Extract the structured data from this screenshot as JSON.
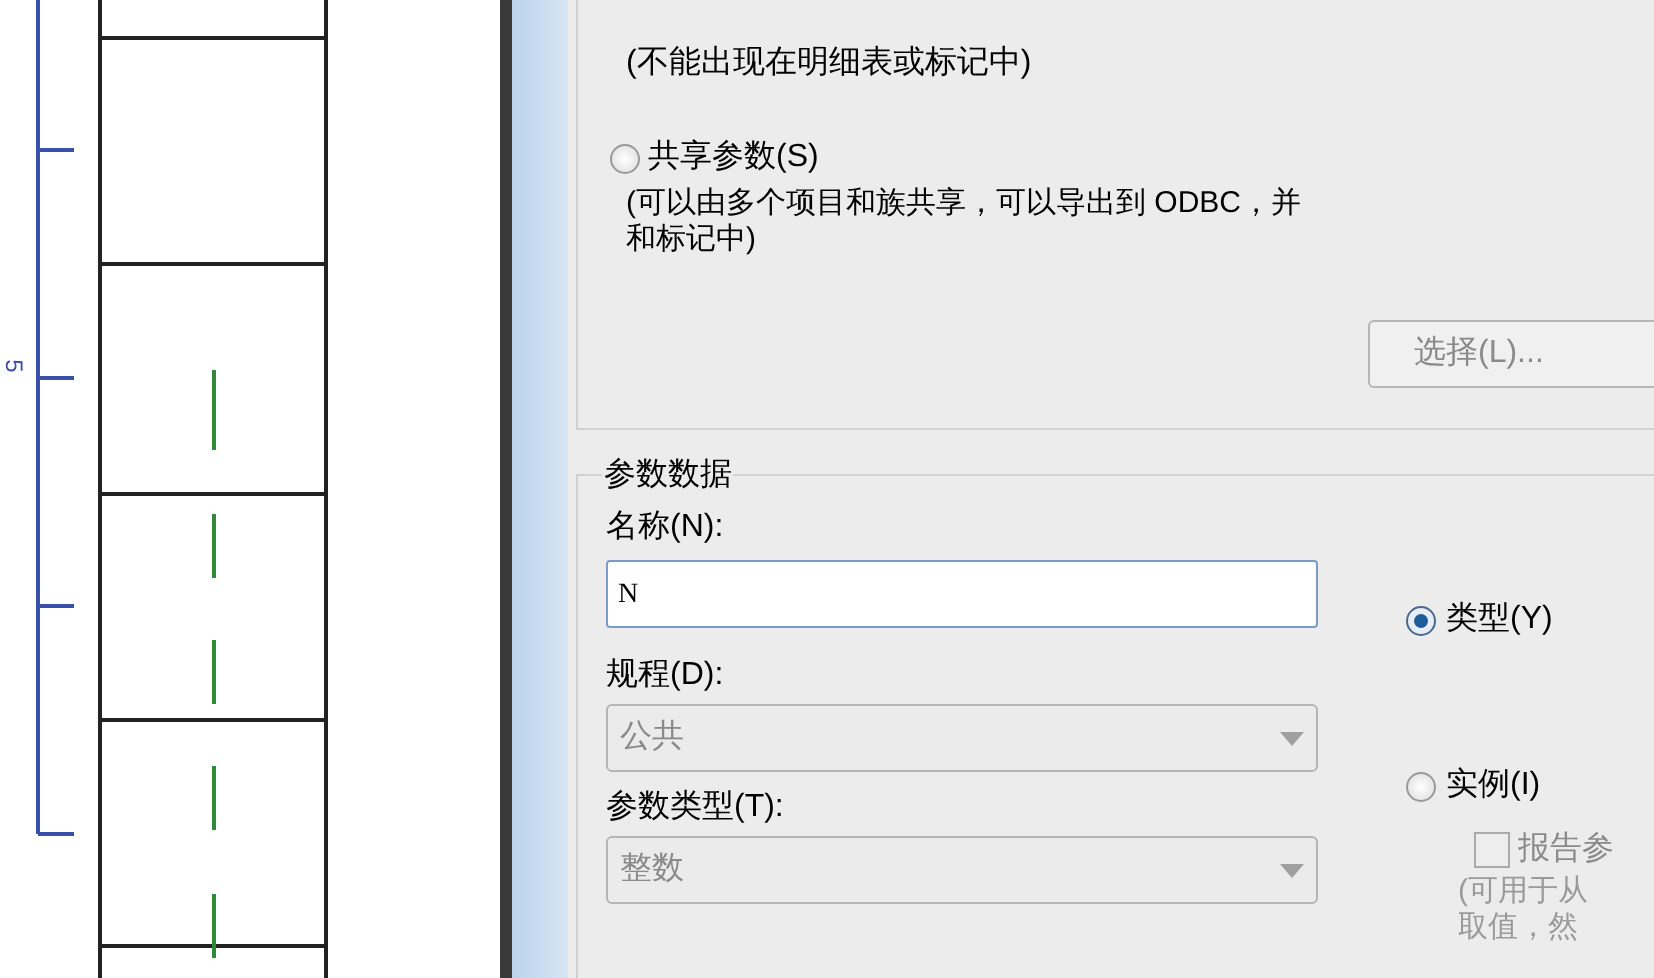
{
  "drawing": {
    "dimension": "5"
  },
  "family_option": {
    "note": "(不能出现在明细表或标记中)"
  },
  "shared_option": {
    "label": "共享参数(S)",
    "selected": false,
    "note_lines": [
      "(可以由多个项目和族共享，可以导出到 ODBC，并",
      "和标记中)"
    ]
  },
  "select_button": "选择(L)...",
  "parameter_data": {
    "title": "参数数据",
    "name_label": "名称(N):",
    "name_value": "N",
    "discipline": {
      "label": "规程(D):",
      "value": "公共",
      "disabled": true
    },
    "parameter_type": {
      "label": "参数类型(T):",
      "value": "整数",
      "disabled": true
    },
    "scope": [
      {
        "label": "类型(Y)",
        "selected": true
      },
      {
        "label": "实例(I)",
        "selected": false
      }
    ],
    "report": {
      "label": "报告参",
      "checked": false
    },
    "report_note_lines": [
      "(可用于从",
      "取值，然"
    ]
  }
}
